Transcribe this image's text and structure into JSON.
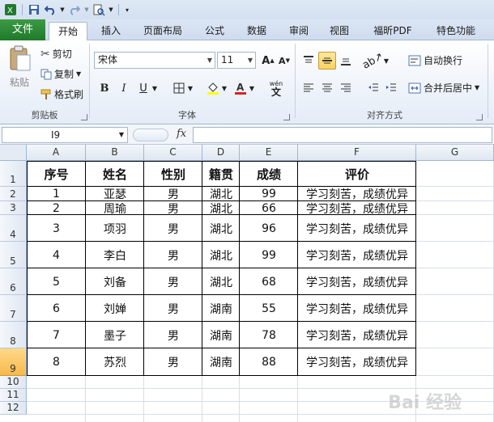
{
  "ribbon_tabs": [
    {
      "label": "文件"
    },
    {
      "label": "开始"
    },
    {
      "label": "插入"
    },
    {
      "label": "页面布局"
    },
    {
      "label": "公式"
    },
    {
      "label": "数据"
    },
    {
      "label": "审阅"
    },
    {
      "label": "视图"
    },
    {
      "label": "福昕PDF"
    },
    {
      "label": "特色功能"
    }
  ],
  "clipboard": {
    "paste": "粘贴",
    "cut": "剪切",
    "copy": "复制",
    "format_painter": "格式刷",
    "group": "剪贴板"
  },
  "font": {
    "name": "宋体",
    "size": "11",
    "bold": "B",
    "italic": "I",
    "underline": "U",
    "group": "字体"
  },
  "alignment": {
    "wrap": "自动换行",
    "merge": "合并后居中",
    "group": "对齐方式"
  },
  "formula_bar": {
    "name_box": "I9",
    "fx": "fx"
  },
  "columns": [
    "A",
    "B",
    "C",
    "D",
    "E",
    "F",
    "G"
  ],
  "rows": [
    "1",
    "2",
    "3",
    "4",
    "5",
    "6",
    "7",
    "8",
    "9",
    "10",
    "11",
    "12"
  ],
  "table": {
    "headers": [
      "序号",
      "姓名",
      "性别",
      "籍贯",
      "成绩",
      "评价"
    ],
    "rows": [
      [
        "1",
        "亚瑟",
        "男",
        "湖北",
        "99",
        "学习刻苦，成绩优异"
      ],
      [
        "2",
        "周瑜",
        "男",
        "湖北",
        "66",
        "学习刻苦，成绩优异"
      ],
      [
        "3",
        "项羽",
        "男",
        "湖北",
        "96",
        "学习刻苦，成绩优异"
      ],
      [
        "4",
        "李白",
        "男",
        "湖北",
        "99",
        "学习刻苦，成绩优异"
      ],
      [
        "5",
        "刘备",
        "男",
        "湖北",
        "68",
        "学习刻苦，成绩优异"
      ],
      [
        "6",
        "刘婵",
        "男",
        "湖南",
        "55",
        "学习刻苦，成绩优异"
      ],
      [
        "7",
        "墨子",
        "男",
        "湖南",
        "78",
        "学习刻苦，成绩优异"
      ],
      [
        "8",
        "苏烈",
        "男",
        "湖南",
        "88",
        "学习刻苦，成绩优异"
      ]
    ]
  },
  "selected_row": "9",
  "watermark": "Bai 经验",
  "colors": {
    "file_tab": "#1f7a2a",
    "selection": "#f6b94b"
  }
}
